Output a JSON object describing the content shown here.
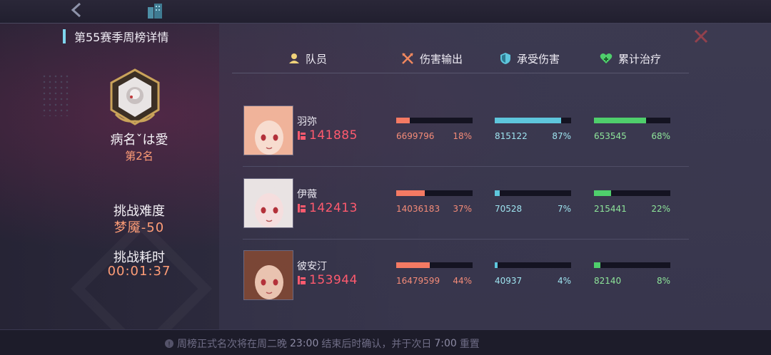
{
  "title": "第55赛季周榜详情",
  "icons": {
    "back": "back-chevron-icon",
    "building": "building-icon",
    "close": "close-icon",
    "member": "member-icon",
    "damage": "crossed-swords-icon",
    "taken": "shield-icon",
    "heal": "heart-icon",
    "power": "power-fist-icon"
  },
  "player": {
    "name": "病名ˇは愛",
    "rank": "第2名",
    "difficulty_label": "挑战难度",
    "difficulty_value": "梦魇-50",
    "time_label": "挑战耗时",
    "time_value": "00:01:37"
  },
  "columns": {
    "member": "队员",
    "damage": "伤害输出",
    "taken": "承受伤害",
    "heal": "累计治疗"
  },
  "members": [
    {
      "name": "羽弥",
      "power": "141885",
      "damage": "6699796",
      "damage_pct": "18%",
      "damage_fill": 18,
      "taken": "815122",
      "taken_pct": "87%",
      "taken_fill": 87,
      "heal": "653545",
      "heal_pct": "68%",
      "heal_fill": 68,
      "hair": "#f0b39a",
      "skin": "#f7dccf"
    },
    {
      "name": "伊薇",
      "power": "142413",
      "damage": "14036183",
      "damage_pct": "37%",
      "damage_fill": 37,
      "taken": "70528",
      "taken_pct": "7%",
      "taken_fill": 7,
      "heal": "215441",
      "heal_pct": "22%",
      "heal_fill": 22,
      "hair": "#e9e3e3",
      "skin": "#f5dede"
    },
    {
      "name": "彼安汀",
      "power": "153944",
      "damage": "16479599",
      "damage_pct": "44%",
      "damage_fill": 44,
      "taken": "40937",
      "taken_pct": "4%",
      "taken_fill": 4,
      "heal": "82140",
      "heal_pct": "8%",
      "heal_fill": 8,
      "hair": "#7a4636",
      "skin": "#e9c3b0"
    }
  ],
  "footer": {
    "pre": "周榜正式名次将在周二晚",
    "time1": "23:00",
    "mid": "结束后时确认，并于次日",
    "time2": "7:00",
    "post": "重置"
  },
  "colors": {
    "damage": "#f47a63",
    "taken": "#5ec6dc",
    "heal": "#4fcf6c",
    "accent": "#ff9d77"
  }
}
